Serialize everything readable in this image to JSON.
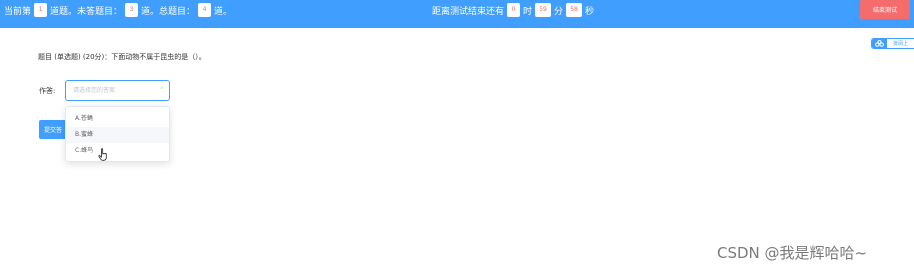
{
  "header": {
    "current_prefix": "当前第",
    "current_num": "1",
    "current_suffix": "道题。未答题目：",
    "unanswered_num": "3",
    "unanswered_suffix": "道。总题目：",
    "total_num": "4",
    "total_suffix": "道。",
    "timer_prefix": "距离测试结束还有",
    "hours": "0",
    "hours_unit": "时",
    "minutes": "59",
    "minutes_unit": "分",
    "seconds": "58",
    "seconds_unit": "秒",
    "end_button": "结束测试"
  },
  "side": {
    "icon": "collection-icon",
    "label": "批阅上"
  },
  "question": {
    "text": "题目 (单选题) (20分)：下面动物不属于昆虫的是（）。"
  },
  "answer": {
    "label": "作答:",
    "placeholder": "请选择您的答案",
    "arrow": "⌃",
    "options": [
      {
        "label": "A.苍蝇"
      },
      {
        "label": "B.蜜蜂"
      },
      {
        "label": "C.蜂鸟"
      }
    ],
    "hovered_index": 1
  },
  "submit": {
    "label": "提交答"
  },
  "watermark": "CSDN @我是辉哈哈~",
  "colors": {
    "primary": "#409eff",
    "danger": "#f56c6c"
  }
}
